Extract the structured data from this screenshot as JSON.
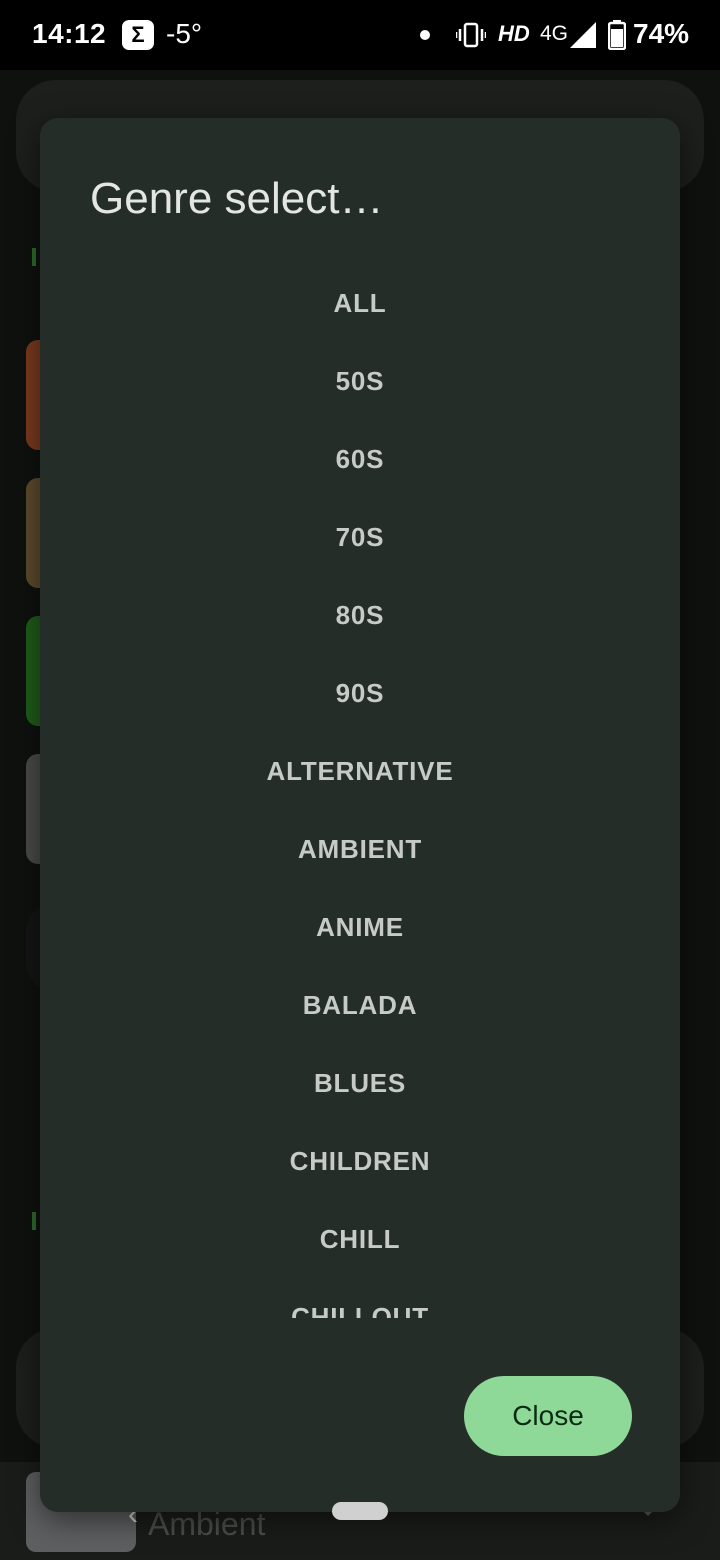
{
  "status_bar": {
    "time": "14:12",
    "app_icon_glyph": "Σ",
    "temperature": "-5°",
    "hd": "HD",
    "network": "4G",
    "battery": "74%"
  },
  "background": {
    "now_playing_title": "Ambient"
  },
  "dialog": {
    "title": "Genre select…",
    "genres": [
      "ALL",
      "50S",
      "60S",
      "70S",
      "80S",
      "90S",
      "ALTERNATIVE",
      "AMBIENT",
      "ANIME",
      "BALADA",
      "BLUES",
      "CHILDREN",
      "CHILL",
      "CHILLOUT"
    ],
    "close_label": "Close"
  },
  "colors": {
    "dialog_bg": "#252d28",
    "accent_button": "#8ed998",
    "list_text": "#c7cbc6"
  }
}
